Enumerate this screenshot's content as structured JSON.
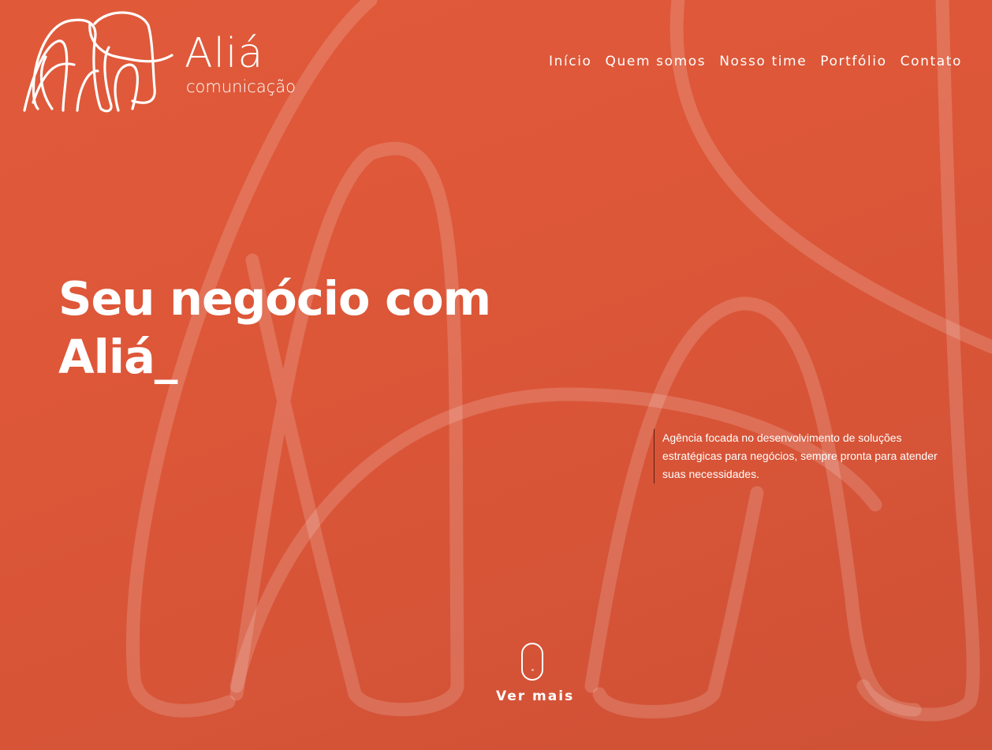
{
  "brand": {
    "name": "Aliá",
    "tagline": "comunicação",
    "logo_icon": "elephant-outline-icon"
  },
  "nav": {
    "items": [
      {
        "label": "Início"
      },
      {
        "label": "Quem somos"
      },
      {
        "label": "Nosso time"
      },
      {
        "label": "Portfólio"
      },
      {
        "label": "Contato"
      }
    ]
  },
  "hero": {
    "headline_line1": "Seu negócio com",
    "headline_line2": "Aliá_",
    "description": "Agência focada no desenvolvimento de soluções estratégicas para negócios, sempre pronta para atender suas necessidades.",
    "scroll_icon": "mouse-scroll-icon",
    "scroll_label": "Ver mais"
  },
  "colors": {
    "background": "#e05a3a",
    "text": "#ffffff",
    "background_art": "#ffffff"
  }
}
